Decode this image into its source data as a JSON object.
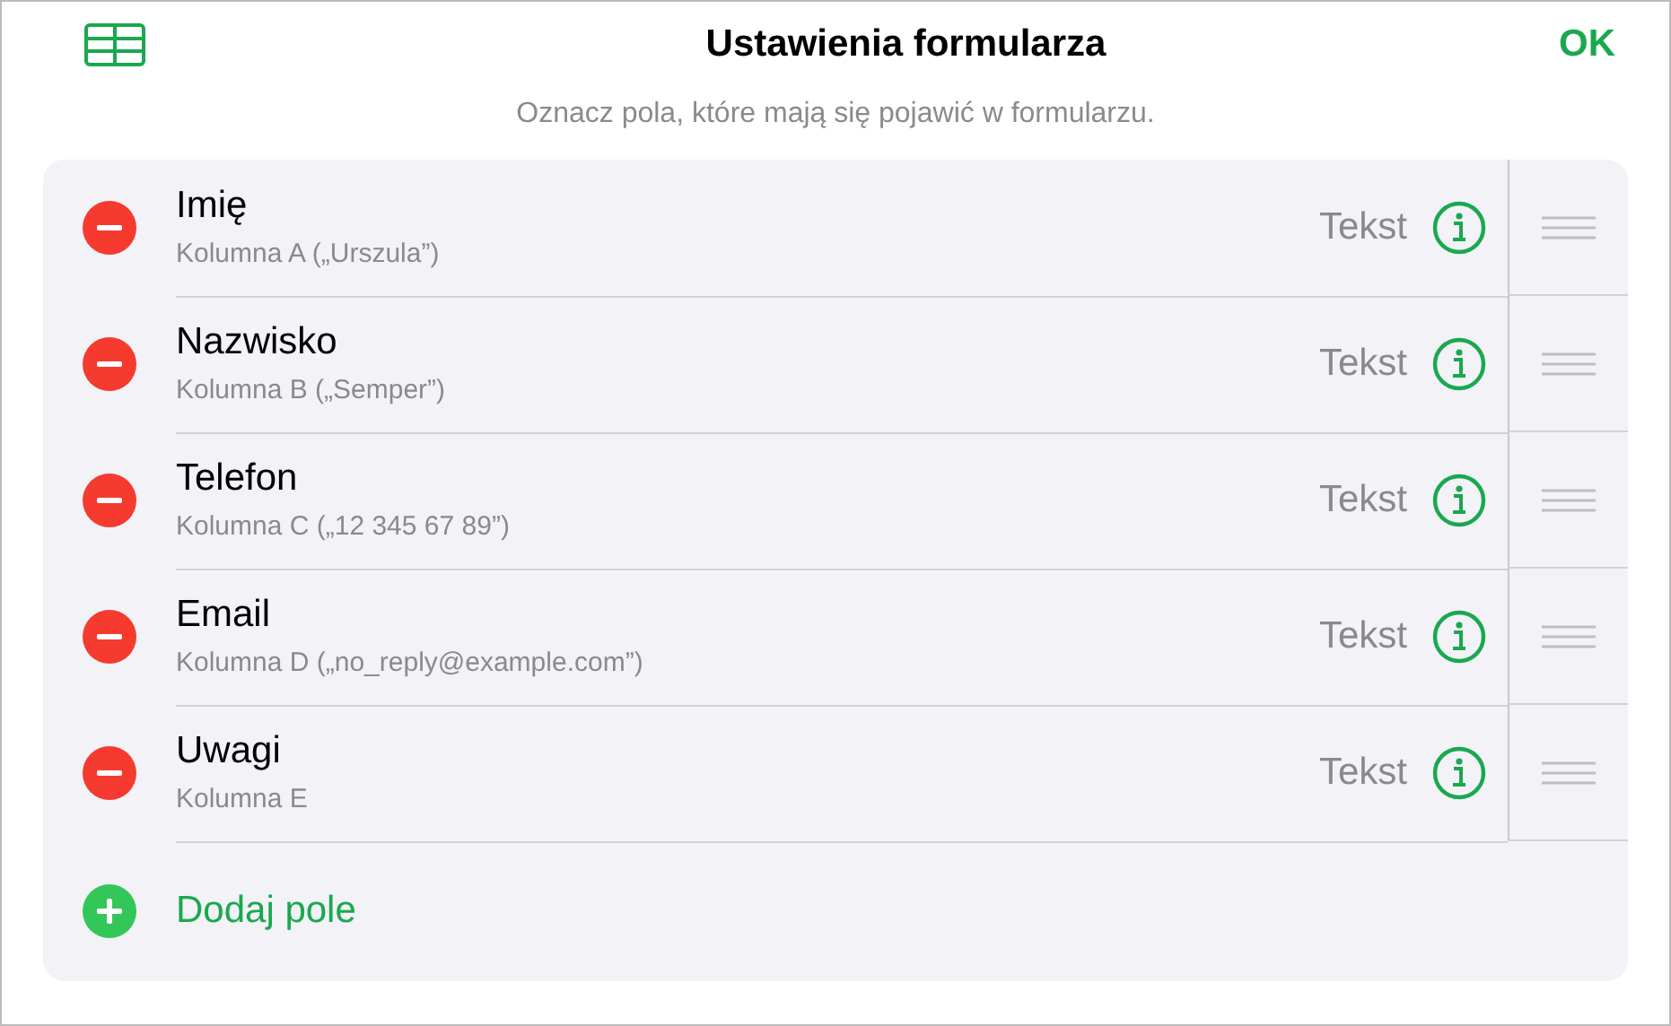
{
  "header": {
    "title": "Ustawienia formularza",
    "done": "OK"
  },
  "hint": "Oznacz pola, które mają się pojawić w formularzu.",
  "fields": [
    {
      "name": "Imię",
      "source": "Kolumna A („Urszula”)",
      "type": "Tekst"
    },
    {
      "name": "Nazwisko",
      "source": "Kolumna B („Semper”)",
      "type": "Tekst"
    },
    {
      "name": "Telefon",
      "source": "Kolumna C („12 345 67 89”)",
      "type": "Tekst"
    },
    {
      "name": "Email",
      "source": "Kolumna D („no_reply@example.com”)",
      "type": "Tekst"
    },
    {
      "name": "Uwagi",
      "source": "Kolumna E",
      "type": "Tekst"
    }
  ],
  "add_button": "Dodaj pole"
}
